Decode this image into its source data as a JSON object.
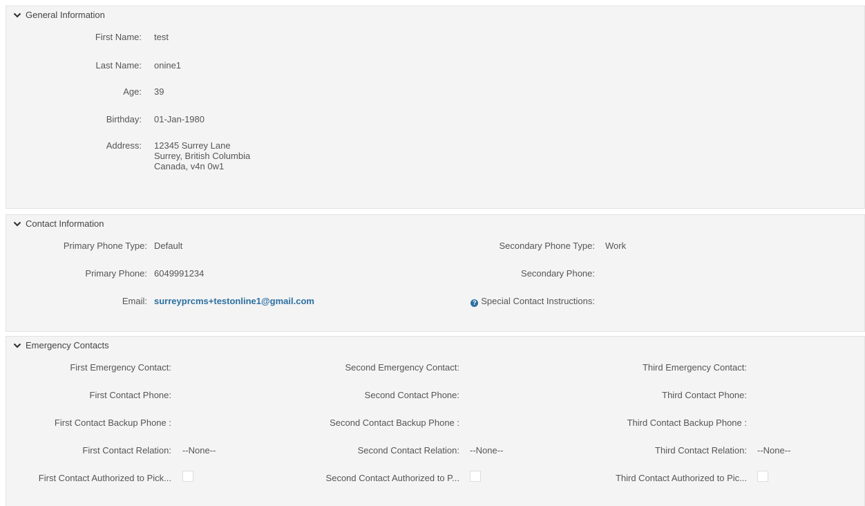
{
  "general": {
    "title": "General Information",
    "first_name_label": "First Name:",
    "first_name": "test",
    "last_name_label": "Last Name:",
    "last_name": "onine1",
    "age_label": "Age:",
    "age": "39",
    "birthday_label": "Birthday:",
    "birthday": "01-Jan-1980",
    "address_label": "Address:",
    "address": "12345 Surrey Lane\nSurrey, British Columbia\nCanada, v4n 0w1"
  },
  "contact": {
    "title": "Contact Information",
    "primary_phone_type_label": "Primary Phone Type:",
    "primary_phone_type": "Default",
    "primary_phone_label": "Primary Phone:",
    "primary_phone": "6049991234",
    "email_label": "Email:",
    "email": "surreyprcms+testonline1@gmail.com",
    "secondary_phone_type_label": "Secondary Phone Type:",
    "secondary_phone_type": "Work",
    "secondary_phone_label": "Secondary Phone:",
    "special_instructions_label": "Special Contact Instructions:"
  },
  "emergency": {
    "title": "Emergency Contacts",
    "first": {
      "contact_label": "First Emergency Contact:",
      "phone_label": "First Contact Phone:",
      "backup_label": "First Contact Backup Phone :",
      "relation_label": "First Contact Relation:",
      "relation": "--None--",
      "authorized_label": "First Contact Authorized to Pick..."
    },
    "second": {
      "contact_label": "Second Emergency Contact:",
      "phone_label": "Second Contact Phone:",
      "backup_label": "Second Contact Backup Phone :",
      "relation_label": "Second Contact Relation:",
      "relation": "--None--",
      "authorized_label": "Second Contact Authorized to P..."
    },
    "third": {
      "contact_label": "Third Emergency Contact:",
      "phone_label": "Third Contact Phone:",
      "backup_label": "Third Contact Backup Phone :",
      "relation_label": "Third Contact Relation:",
      "relation": "--None--",
      "authorized_label": "Third Contact Authorized to Pic..."
    }
  },
  "icons": {
    "section_toggle": "chevron-down-icon",
    "help": "question-circle-icon"
  },
  "colors": {
    "link": "#2c6fa0",
    "section_bg": "#f4f4f4"
  }
}
